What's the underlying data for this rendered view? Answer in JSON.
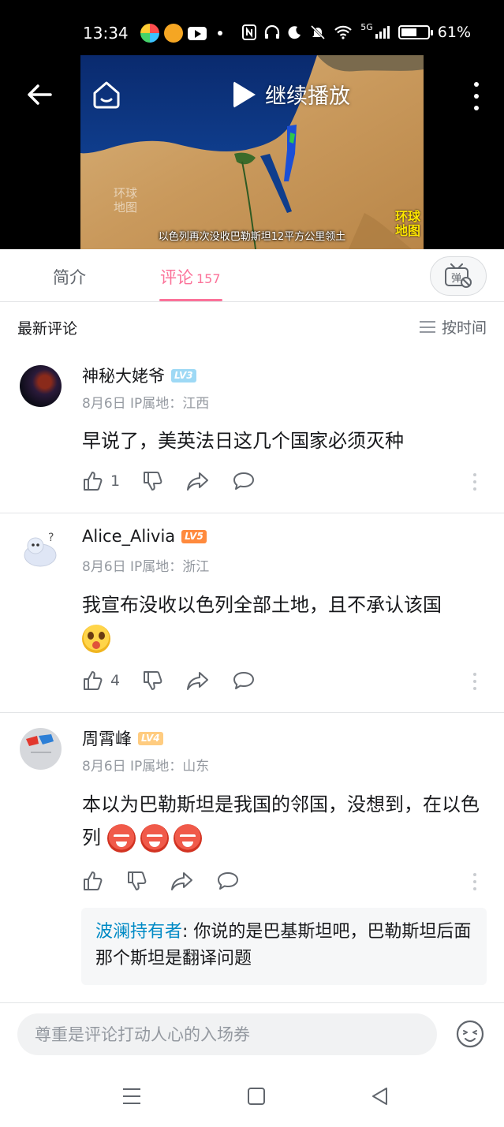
{
  "status_bar": {
    "time": "13:34",
    "network": "5G",
    "battery": "61%",
    "battery_level": 0.61,
    "icons": [
      "nfc-icon",
      "headphones-icon",
      "moon-icon",
      "mute-icon",
      "wifi-icon",
      "signal-icon"
    ]
  },
  "video": {
    "resume_label": "继续播放",
    "caption": "以色列再次没收巴勒斯坦12平方公里领土",
    "logo": [
      "环球",
      "地图"
    ],
    "watermark": [
      "环球",
      "地图"
    ]
  },
  "tabs": [
    {
      "label": "简介",
      "count": ""
    },
    {
      "label": "评论",
      "count": "157"
    }
  ],
  "list_header": {
    "title": "最新评论",
    "sort_label": "按时间"
  },
  "comments": [
    {
      "username": "神秘大姥爷",
      "level": "LV3",
      "level_color": "#9ed9f5",
      "date": "8月6日",
      "ip": "IP属地：江西",
      "content": "早说了，美英法日这几个国家必须灭种",
      "likes": "1"
    },
    {
      "username": "Alice_Alivia",
      "level": "LV5",
      "level_color": "#ff8a3d",
      "date": "8月6日",
      "ip": "IP属地：浙江",
      "content": "我宣布没收以色列全部土地，且不承认该国",
      "likes": "4"
    },
    {
      "username": "周霄峰",
      "level": "LV4",
      "level_color": "#ffcc80",
      "date": "8月6日",
      "ip": "IP属地：山东",
      "content": "本以为巴勒斯坦是我国的邻国，没想到，在以色列",
      "likes": "",
      "reply": {
        "user": "波澜持有者",
        "text": ": 你说的是巴基斯坦吧，巴勒斯坦后面那个斯坦是翻译问题"
      }
    }
  ],
  "input": {
    "placeholder": "尊重是评论打动人心的入场券"
  },
  "colors": {
    "accent": "#fb7299",
    "link": "#008ac5",
    "text_secondary": "#9499a0"
  }
}
